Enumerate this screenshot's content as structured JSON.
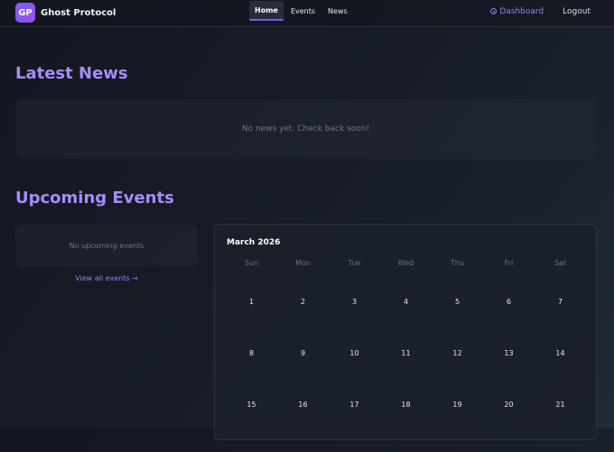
{
  "nav": {
    "logo_text": "GP",
    "brand": "Ghost Protocol",
    "links": [
      {
        "label": "Home",
        "active": true
      },
      {
        "label": "Events",
        "active": false
      },
      {
        "label": "News",
        "active": false
      }
    ],
    "dashboard_label": "Dashboard",
    "logout_label": "Logout"
  },
  "news": {
    "title": "Latest News",
    "empty_text": "No news yet. Check back soon!"
  },
  "events": {
    "title": "Upcoming Events",
    "empty_text": "No upcoming events",
    "view_all_label": "View all events →"
  },
  "calendar": {
    "month": "March 2026",
    "weekdays": [
      "Sun",
      "Mon",
      "Tue",
      "Wed",
      "Thu",
      "Fri",
      "Sat"
    ],
    "weeks": [
      [
        "1",
        "2",
        "3",
        "4",
        "5",
        "6",
        "7"
      ],
      [
        "8",
        "9",
        "10",
        "11",
        "12",
        "13",
        "14"
      ],
      [
        "15",
        "16",
        "17",
        "18",
        "19",
        "20",
        "21"
      ]
    ]
  },
  "colors": {
    "accent": "#a78bfa",
    "link": "#8f86f2",
    "background": "#161b25"
  }
}
